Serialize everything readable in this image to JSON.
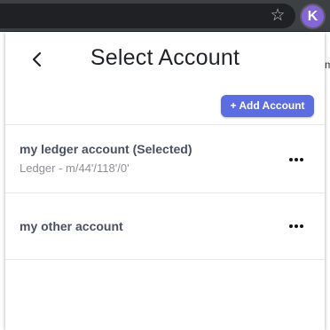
{
  "browser": {
    "extension_avatar_letter": "K",
    "star_icon": "star-icon",
    "background_page_text": "m"
  },
  "popup": {
    "back_icon": "chevron-left-icon",
    "title": "Select Account",
    "add_account_label": "+ Add Account",
    "accounts": [
      {
        "name": "my ledger account (Selected)",
        "path": "Ledger - m/44'/118'/0'",
        "menu_icon": "more-horizontal-icon"
      },
      {
        "name": "my other account",
        "path": "",
        "menu_icon": "more-horizontal-icon"
      }
    ]
  },
  "colors": {
    "accent": "#5b6de0",
    "extension_avatar": "#8566d9",
    "toolbar": "#3c4043"
  }
}
